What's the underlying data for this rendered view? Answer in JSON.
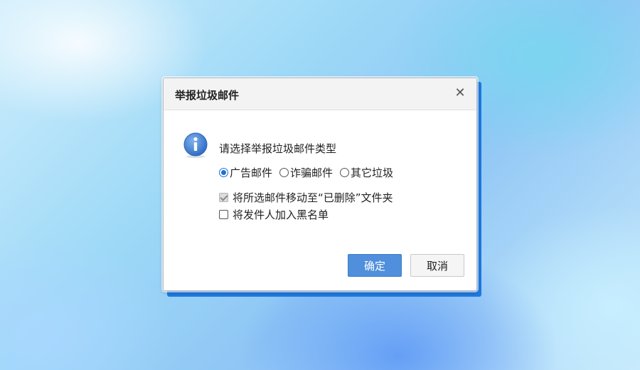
{
  "dialog": {
    "title": "举报垃圾邮件",
    "close_glyph": "✕",
    "prompt": "请选择举报垃圾邮件类型",
    "report_types": [
      {
        "label": "广告邮件",
        "checked": true
      },
      {
        "label": "诈骗邮件",
        "checked": false
      },
      {
        "label": "其它垃圾",
        "checked": false
      }
    ],
    "options": [
      {
        "label": "将所选邮件移动至“已删除”文件夹",
        "checked": true,
        "disabled": true
      },
      {
        "label": "将发件人加入黑名单",
        "checked": false,
        "disabled": false
      }
    ],
    "ok_label": "确定",
    "cancel_label": "取消"
  },
  "icons": {
    "info": "info-icon",
    "close": "close-icon"
  },
  "colors": {
    "accent": "#1f6fd6",
    "ok_button": "#4f8fdc",
    "dialog_frame": "#1f79e0"
  }
}
